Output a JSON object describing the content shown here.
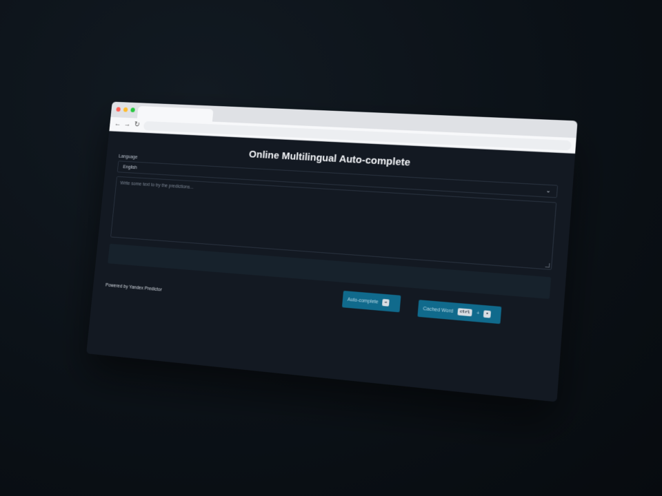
{
  "page": {
    "title": "Online Multilingual Auto-complete"
  },
  "form": {
    "language_label": "Language",
    "language_value": "English",
    "text_placeholder": "Write some text to try the predictions..."
  },
  "footer": {
    "powered_by": "Powered by Yandex Predictor"
  },
  "actions": {
    "autocomplete_label": "Auto-complete",
    "autocomplete_key": "→",
    "cached_label": "Cached Word",
    "cached_key_modifier": "ctrl",
    "cached_plus": "+",
    "cached_key": "•"
  },
  "browser": {
    "back_icon": "←",
    "forward_icon": "→",
    "reload_icon": "↻"
  },
  "colors": {
    "accent": "#106a8c",
    "background": "#131922"
  }
}
